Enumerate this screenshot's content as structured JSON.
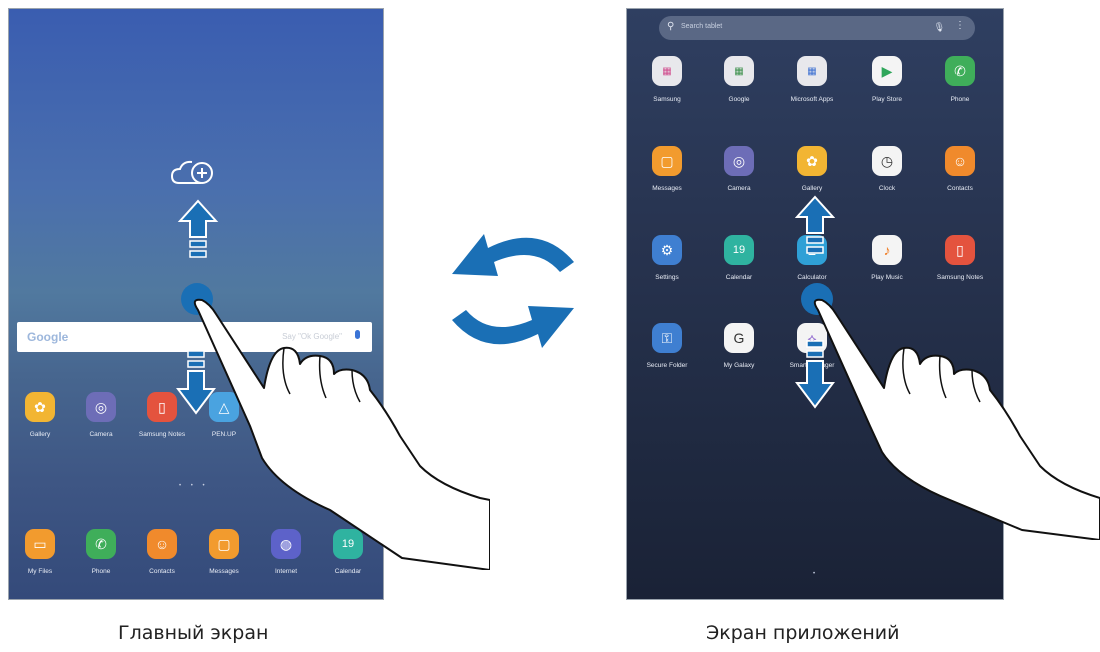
{
  "home_screen": {
    "search_logo": "Google",
    "search_hint": "Say \"Ok Google\"",
    "apps": [
      {
        "label": "Gallery",
        "icon": "flower-icon",
        "color": "#f2b533"
      },
      {
        "label": "Camera",
        "icon": "camera-icon",
        "color": "#6d6db7"
      },
      {
        "label": "Samsung Notes",
        "icon": "notes-icon",
        "color": "#e4533e"
      },
      {
        "label": "PEN.UP",
        "icon": "pen-icon",
        "color": "#4aa3e0"
      }
    ],
    "dock": [
      {
        "label": "My Files",
        "icon": "folder-icon",
        "color": "#f29b2e"
      },
      {
        "label": "Phone",
        "icon": "phone-icon",
        "color": "#3fae5a"
      },
      {
        "label": "Contacts",
        "icon": "contact-icon",
        "color": "#f08a2c"
      },
      {
        "label": "Messages",
        "icon": "message-icon",
        "color": "#f29b2e"
      },
      {
        "label": "Internet",
        "icon": "globe-icon",
        "color": "#5d62c9"
      },
      {
        "label": "Calendar",
        "icon": "calendar-icon",
        "color": "#2fb3a0",
        "text": "19"
      }
    ]
  },
  "apps_screen": {
    "search_placeholder": "Search tablet",
    "apps": [
      {
        "label": "Samsung",
        "icon": "folder-icon",
        "color": "#e8e8ec"
      },
      {
        "label": "Google",
        "icon": "folder-icon",
        "color": "#e8e8ec"
      },
      {
        "label": "Microsoft Apps",
        "icon": "folder-icon",
        "color": "#e8e8ec"
      },
      {
        "label": "Play Store",
        "icon": "play-store-icon",
        "color": "#f4f4f4"
      },
      {
        "label": "Phone",
        "icon": "phone-icon",
        "color": "#3fae5a"
      },
      {
        "label": "Messages",
        "icon": "message-icon",
        "color": "#f29b2e"
      },
      {
        "label": "Camera",
        "icon": "camera-icon",
        "color": "#6d6db7"
      },
      {
        "label": "Gallery",
        "icon": "flower-icon",
        "color": "#f2b533"
      },
      {
        "label": "Clock",
        "icon": "clock-icon",
        "color": "#f4f4f4"
      },
      {
        "label": "Contacts",
        "icon": "contact-icon",
        "color": "#f08a2c"
      },
      {
        "label": "Settings",
        "icon": "gear-icon",
        "color": "#3f7fd1"
      },
      {
        "label": "Calendar",
        "icon": "calendar-icon",
        "color": "#2fb3a0",
        "text": "19"
      },
      {
        "label": "Calculator",
        "icon": "calculator-icon",
        "color": "#2fa0d6"
      },
      {
        "label": "Play Music",
        "icon": "music-icon",
        "color": "#f4f4f4"
      },
      {
        "label": "Samsung Notes",
        "icon": "notes-icon",
        "color": "#e4533e"
      },
      {
        "label": "Secure Folder",
        "icon": "secure-folder-icon",
        "color": "#3f7fd1"
      },
      {
        "label": "My Galaxy",
        "icon": "galaxy-icon",
        "color": "#f4f4f4"
      },
      {
        "label": "Smart Manager",
        "icon": "smart-manager-icon",
        "color": "#f4f4f4"
      }
    ]
  },
  "captions": {
    "home": "Главный экран",
    "apps": "Экран приложений"
  },
  "colors": {
    "arrow": "#1a6fb5",
    "arrow_outline": "#ffffff"
  }
}
